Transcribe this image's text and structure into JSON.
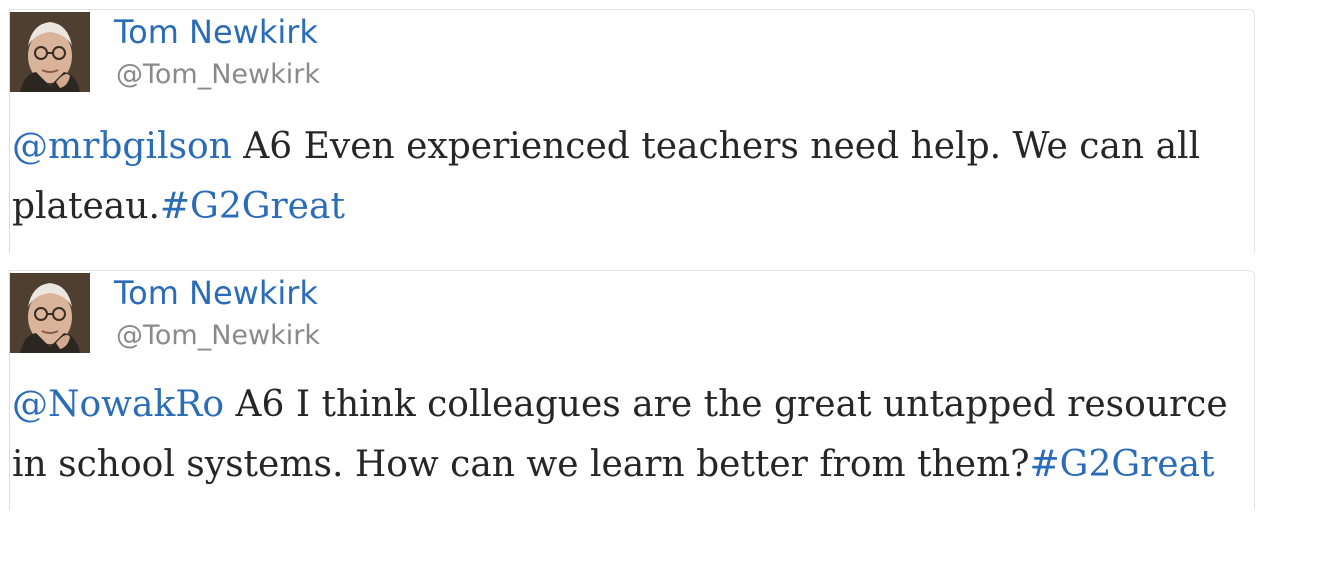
{
  "tweets": [
    {
      "author_name": "Tom Newkirk",
      "author_handle": "@Tom_Newkirk",
      "mention": "@mrbgilson",
      "body": " A6 Even experienced teachers need help. We can all plateau.",
      "hashtag": "#G2Great"
    },
    {
      "author_name": "Tom Newkirk",
      "author_handle": "@Tom_Newkirk",
      "mention": "@NowakRo",
      "body": " A6 I think colleagues are the great untapped resource in school systems. How can we learn better from them?",
      "hashtag": "#G2Great"
    }
  ],
  "colors": {
    "link": "#2b6cb8",
    "handle": "#8a8a8a",
    "text": "#262626"
  },
  "icons": {
    "avatar": "profile-photo"
  }
}
